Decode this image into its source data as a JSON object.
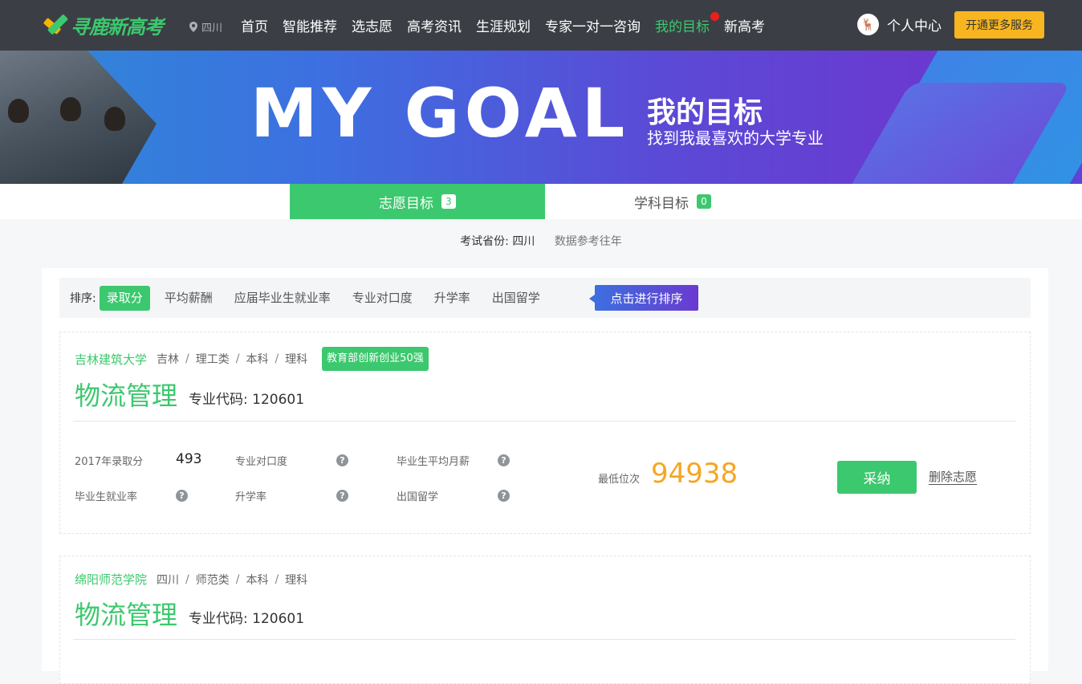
{
  "nav": {
    "logo_text": "寻鹿新高考",
    "location": "四川",
    "items": [
      {
        "label": "首页"
      },
      {
        "label": "智能推荐"
      },
      {
        "label": "选志愿"
      },
      {
        "label": "高考资讯"
      },
      {
        "label": "生涯规划"
      },
      {
        "label": "专家一对一咨询"
      },
      {
        "label": "我的目标"
      },
      {
        "label": "新高考"
      }
    ],
    "active_index": 6,
    "user_label": "个人中心",
    "service_button": "开通更多服务",
    "accent_color": "#3cc86e"
  },
  "banner": {
    "big_text": "MY GOAL",
    "title": "我的目标",
    "subtitle": "找到我最喜欢的大学专业"
  },
  "tabs": [
    {
      "label": "志愿目标",
      "count": "3",
      "active": true
    },
    {
      "label": "学科目标",
      "count": "0",
      "active": false
    }
  ],
  "province": {
    "label": "考试省份:",
    "value": "四川",
    "note": "数据参考往年"
  },
  "sort": {
    "label": "排序:",
    "options": [
      "录取分",
      "平均薪酬",
      "应届毕业生就业率",
      "专业对口度",
      "升学率",
      "出国留学"
    ],
    "active_index": 0,
    "go_button": "点击进行排序"
  },
  "cards": [
    {
      "university": "吉林建筑大学",
      "region": "吉林",
      "type": "理工类",
      "level": "本科",
      "subject": "理科",
      "badge": "教育部创新创业50强",
      "major": "物流管理",
      "major_code": "专业代码: 120601",
      "stats": {
        "score_label": "2017年录取分",
        "score_value": "493",
        "match_label": "专业对口度",
        "salary_label": "毕业生平均月薪",
        "employment_label": "毕业生就业率",
        "further_label": "升学率",
        "abroad_label": "出国留学"
      },
      "rank_label": "最低位次",
      "rank_value": "94938",
      "adopt_button": "采纳",
      "delete_link": "删除志愿"
    },
    {
      "university": "绵阳师范学院",
      "region": "四川",
      "type": "师范类",
      "level": "本科",
      "subject": "理科",
      "major": "物流管理",
      "major_code": "专业代码: 120601"
    }
  ],
  "icons": {
    "help": "?",
    "avatar": "deer-avatar-icon",
    "location": "map-pin-icon"
  }
}
